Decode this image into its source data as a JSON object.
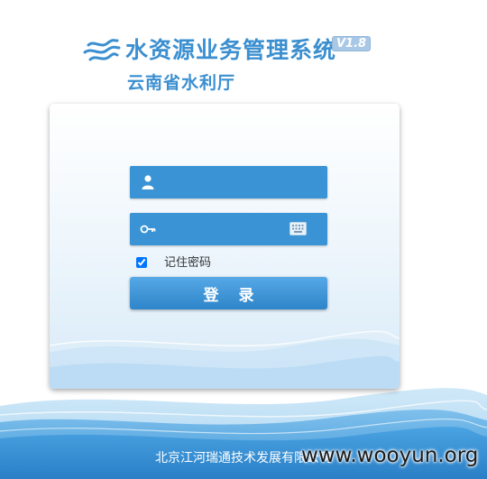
{
  "header": {
    "logo_icon": "water-waves-icon",
    "title": "水资源业务管理系统",
    "version": "V1.8",
    "org": "云南省水利厅"
  },
  "login": {
    "username": {
      "icon": "user-icon",
      "placeholder": "",
      "value": ""
    },
    "password": {
      "icon": "key-icon",
      "placeholder": "",
      "value": "",
      "keyboard_icon": "keyboard-icon"
    },
    "remember": {
      "label": "记住密码",
      "checked": true
    },
    "submit_label": "登 录"
  },
  "footer": {
    "company": "北京江河瑞通技术发展有限公司",
    "watermark": "www.wooyun.org"
  },
  "colors": {
    "brand_blue": "#3b8fd0",
    "field_blue": "#3a93d4",
    "button_top": "#55a9e6",
    "button_bottom": "#2f85c9"
  }
}
